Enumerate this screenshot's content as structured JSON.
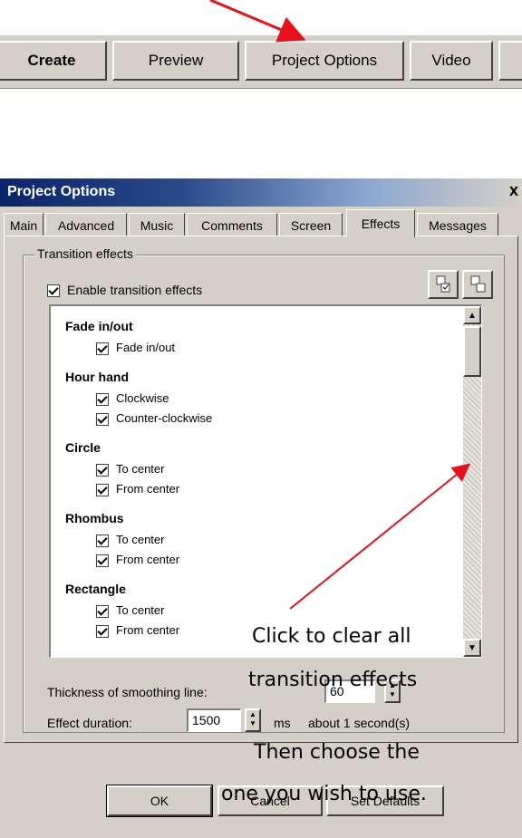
{
  "toolbar": {
    "buttons": [
      "Create",
      "Preview",
      "Project Options",
      "Video",
      ""
    ]
  },
  "dialog": {
    "title": "Project Options",
    "close_glyph": "x",
    "tabs": [
      "Main",
      "Advanced",
      "Music",
      "Comments",
      "Screen",
      "Effects",
      "Messages"
    ],
    "active_tab": "Effects",
    "group_label": "Transition effects",
    "enable_label": "Enable transition effects",
    "enable_checked": true,
    "categories": [
      {
        "name": "Fade in/out",
        "items": [
          "Fade in/out"
        ]
      },
      {
        "name": "Hour hand",
        "items": [
          "Clockwise",
          "Counter-clockwise"
        ]
      },
      {
        "name": "Circle",
        "items": [
          "To center",
          "From center"
        ]
      },
      {
        "name": "Rhombus",
        "items": [
          "To center",
          "From center"
        ]
      },
      {
        "name": "Rectangle",
        "items": [
          "To center",
          "From center"
        ]
      }
    ],
    "thickness_label": "Thickness of smoothing line:",
    "thickness_value": "60",
    "duration_label": "Effect duration:",
    "duration_value": "1500",
    "duration_unit": "ms",
    "duration_note": "about 1 second(s)",
    "buttons": {
      "ok": "OK",
      "cancel": "Cancel",
      "defaults": "Set Defaults"
    }
  },
  "annotation": {
    "line1": "Click to clear all",
    "line2": "transition effects",
    "line3": "Then choose the",
    "line4": "one you wish to use."
  },
  "colors": {
    "arrow": "#e8101a",
    "titlebar": "#0a246a",
    "face": "#d4d0c8"
  }
}
